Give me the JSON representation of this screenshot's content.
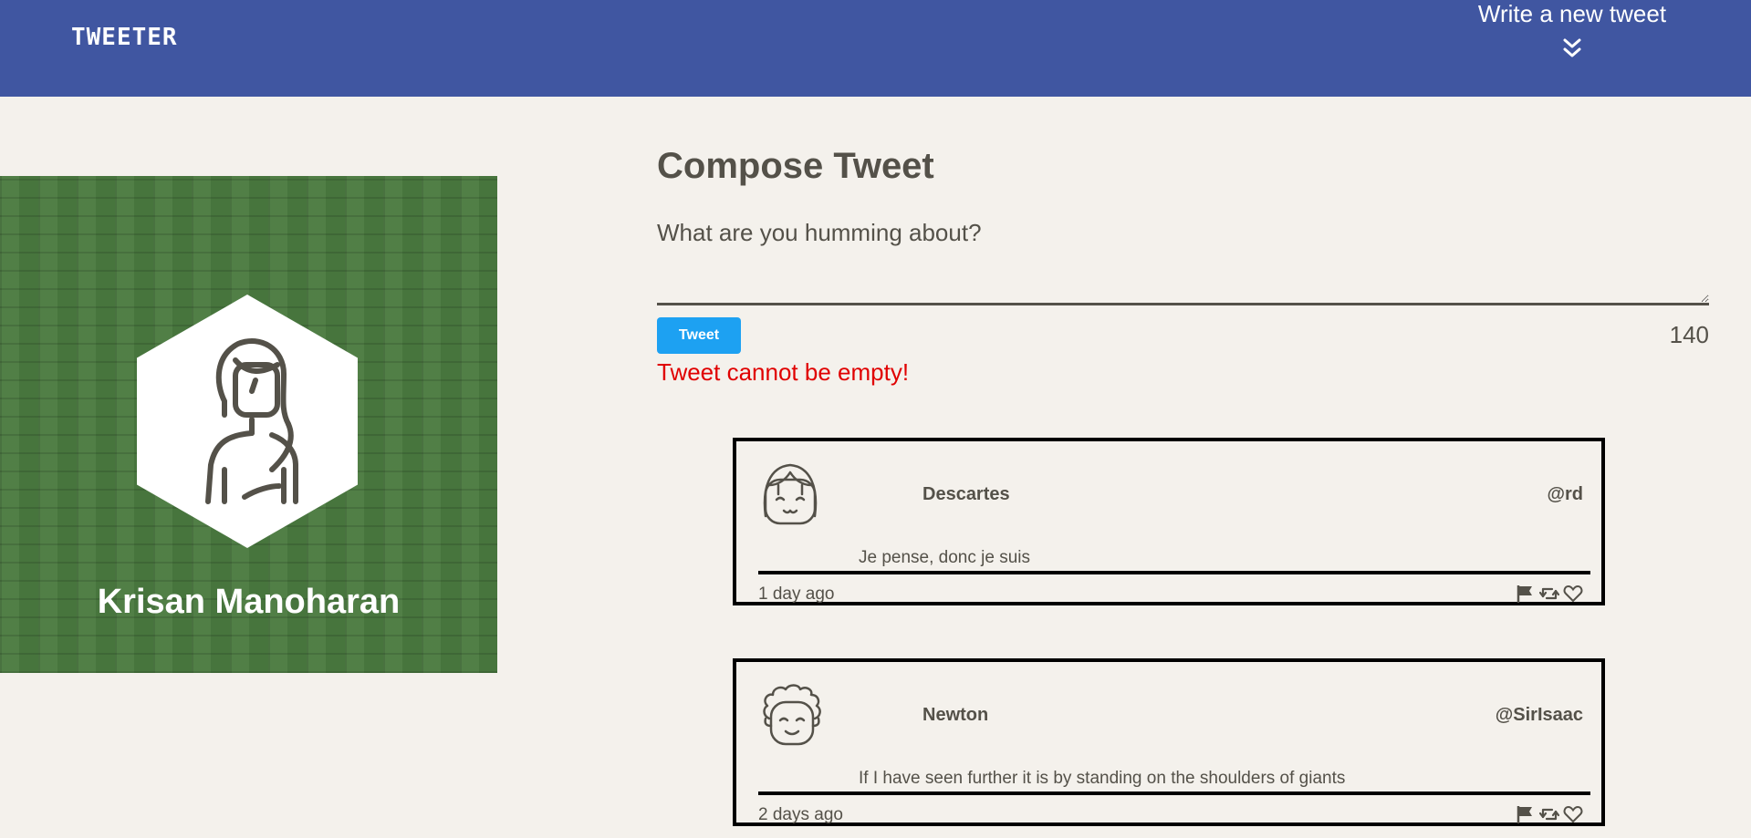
{
  "nav": {
    "logo": "TWEETER",
    "new_tweet_label": "Write a new tweet",
    "new_tweet_icon": "double-chevron-down-icon"
  },
  "profile": {
    "name": "Krisan Manoharan",
    "avatar_icon": "user-avatar-icon"
  },
  "compose": {
    "title": "Compose Tweet",
    "placeholder": "What are you humming about?",
    "button_label": "Tweet",
    "counter": "140",
    "error": "Tweet cannot be empty!"
  },
  "tweets": [
    {
      "name": "Descartes",
      "handle": "@rd",
      "content": "Je pense, donc je suis",
      "time": "1 day ago"
    },
    {
      "name": "Newton",
      "handle": "@SirIsaac",
      "content": "If I have seen further it is by standing on the shoulders of giants",
      "time": "2 days ago"
    }
  ],
  "colors": {
    "nav_bg": "#4056a1",
    "page_bg": "#f4f1ec",
    "text": "#545149",
    "button": "#1da1f2",
    "error": "#e00000",
    "profile_bg": "#4a7a3f"
  }
}
